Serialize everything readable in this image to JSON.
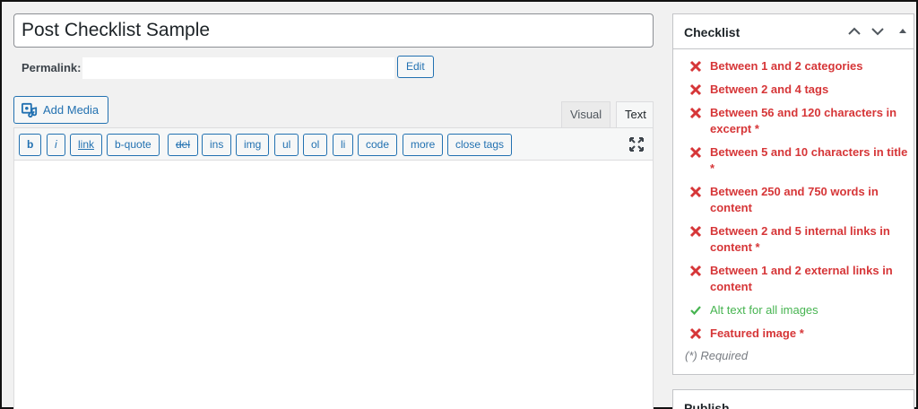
{
  "post": {
    "title": "Post Checklist Sample",
    "permalink_label": "Permalink:",
    "edit_label": "Edit"
  },
  "media": {
    "add_media_label": "Add Media"
  },
  "editor_tabs": {
    "visual": "Visual",
    "text": "Text"
  },
  "quicktags": [
    "b",
    "i",
    "link",
    "b-quote",
    "del",
    "ins",
    "img",
    "ul",
    "ol",
    "li",
    "code",
    "more",
    "close tags"
  ],
  "checklist": {
    "title": "Checklist",
    "items": [
      {
        "text": "Between 1 and 2 categories",
        "status": "fail"
      },
      {
        "text": "Between 2 and 4 tags",
        "status": "fail"
      },
      {
        "text": "Between 56 and 120 characters in excerpt *",
        "status": "fail"
      },
      {
        "text": "Between 5 and 10 characters in title *",
        "status": "fail"
      },
      {
        "text": "Between 250 and 750 words in content",
        "status": "fail"
      },
      {
        "text": "Between 2 and 5 internal links in content *",
        "status": "fail"
      },
      {
        "text": "Between 1 and 2 external links in content",
        "status": "fail"
      },
      {
        "text": "Alt text for all images",
        "status": "pass"
      },
      {
        "text": "Featured image *",
        "status": "fail"
      }
    ],
    "required_note": "(*) Required"
  },
  "publish": {
    "title": "Publish"
  },
  "colors": {
    "fail": "#d63638",
    "pass": "#46b450",
    "accent": "#2271b1"
  }
}
